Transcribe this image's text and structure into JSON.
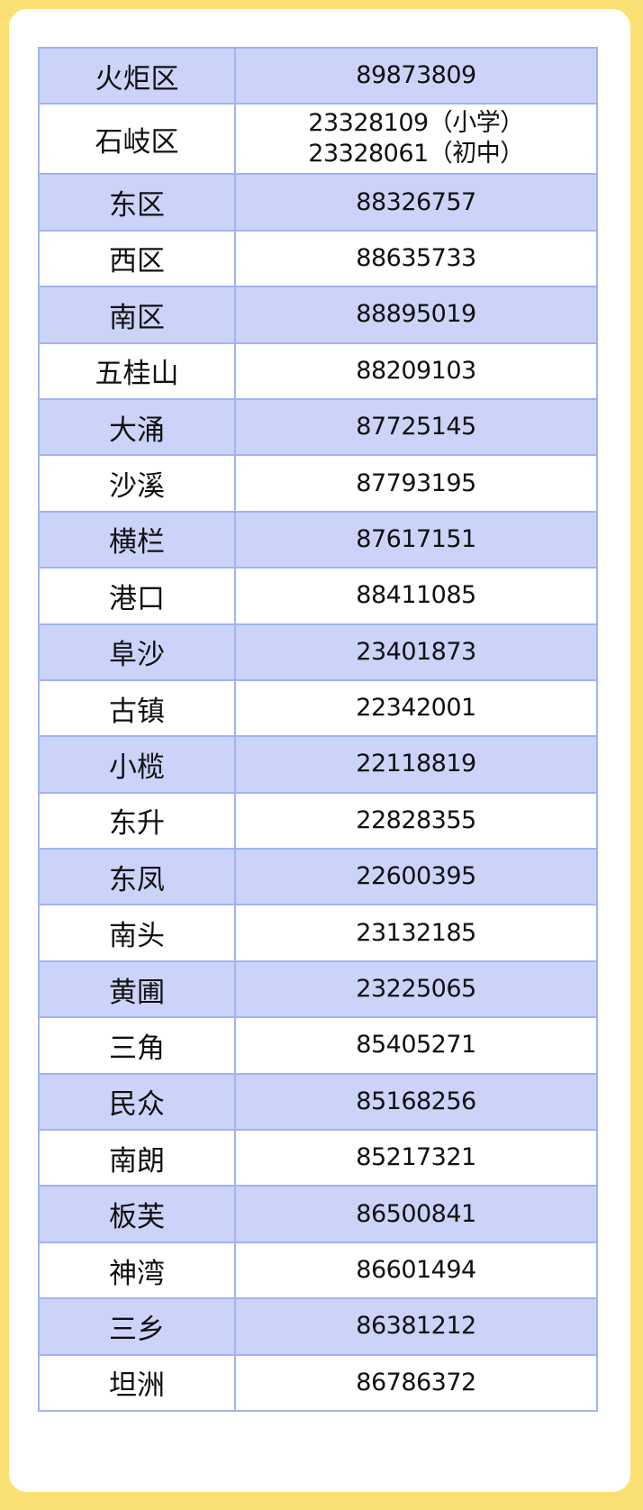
{
  "table": {
    "rows": [
      {
        "district": "火炬区",
        "phones": [
          "89873809"
        ]
      },
      {
        "district": "石岐区",
        "phones": [
          "23328109（小学）",
          "23328061（初中）"
        ]
      },
      {
        "district": "东区",
        "phones": [
          "88326757"
        ]
      },
      {
        "district": "西区",
        "phones": [
          "88635733"
        ]
      },
      {
        "district": "南区",
        "phones": [
          "88895019"
        ]
      },
      {
        "district": "五桂山",
        "phones": [
          "88209103"
        ]
      },
      {
        "district": "大涌",
        "phones": [
          "87725145"
        ]
      },
      {
        "district": "沙溪",
        "phones": [
          "87793195"
        ]
      },
      {
        "district": "横栏",
        "phones": [
          "87617151"
        ]
      },
      {
        "district": "港口",
        "phones": [
          "88411085"
        ]
      },
      {
        "district": "阜沙",
        "phones": [
          "23401873"
        ]
      },
      {
        "district": "古镇",
        "phones": [
          "22342001"
        ]
      },
      {
        "district": "小榄",
        "phones": [
          "22118819"
        ]
      },
      {
        "district": "东升",
        "phones": [
          "22828355"
        ]
      },
      {
        "district": "东凤",
        "phones": [
          "22600395"
        ]
      },
      {
        "district": "南头",
        "phones": [
          "23132185"
        ]
      },
      {
        "district": "黄圃",
        "phones": [
          "23225065"
        ]
      },
      {
        "district": "三角",
        "phones": [
          "85405271"
        ]
      },
      {
        "district": "民众",
        "phones": [
          "85168256"
        ]
      },
      {
        "district": "南朗",
        "phones": [
          "85217321"
        ]
      },
      {
        "district": "板芙",
        "phones": [
          "86500841"
        ]
      },
      {
        "district": "神湾",
        "phones": [
          "86601494"
        ]
      },
      {
        "district": "三乡",
        "phones": [
          "86381212"
        ]
      },
      {
        "district": "坦洲",
        "phones": [
          "86786372"
        ]
      }
    ]
  },
  "colors": {
    "page_background": "#fbe073",
    "card_background": "#ffffff",
    "shaded_row": "#cbd3f8",
    "border": "#9fb4f2"
  }
}
